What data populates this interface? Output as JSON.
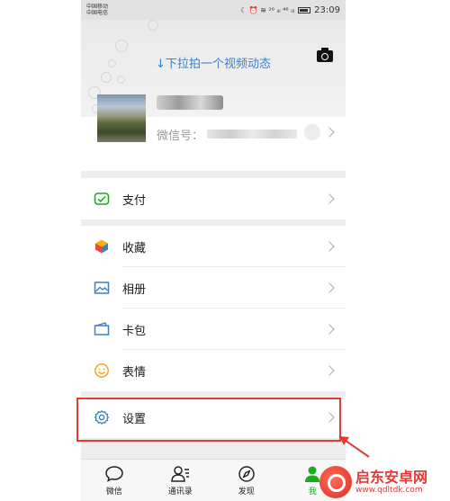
{
  "status_bar": {
    "carrier_1": "中国移动",
    "carrier_2": "中国电信",
    "indicators": "☾ ⏰ ≋ ²⁶ ᵢₗₗ ⁴⁶ ᵢₗₗ",
    "time": "23:09"
  },
  "moments": {
    "pull_text": "↓下拉拍一个视频动态",
    "camera_icon": "camera-icon"
  },
  "profile": {
    "wechat_id_label": "微信号："
  },
  "menu": {
    "pay": {
      "label": "支付",
      "icon": "pay-icon",
      "color": "#1aad19"
    },
    "favorites": {
      "label": "收藏",
      "icon": "favorites-cube-icon"
    },
    "album": {
      "label": "相册",
      "icon": "album-icon",
      "color": "#3d7fc9"
    },
    "cards": {
      "label": "卡包",
      "icon": "card-wallet-icon",
      "color": "#3d7fc9"
    },
    "stickers": {
      "label": "表情",
      "icon": "smiley-icon",
      "color": "#f5a623"
    },
    "settings": {
      "label": "设置",
      "icon": "gear-icon",
      "color": "#3d7fc9"
    }
  },
  "tabbar": {
    "chats": "微信",
    "contacts": "通讯录",
    "discover": "发现",
    "me": "我",
    "active_color": "#1aad19"
  },
  "annotation": {
    "highlight_color": "#e53935"
  },
  "watermark": {
    "title": "启东安卓网",
    "url": "www.qdltdk.com"
  }
}
